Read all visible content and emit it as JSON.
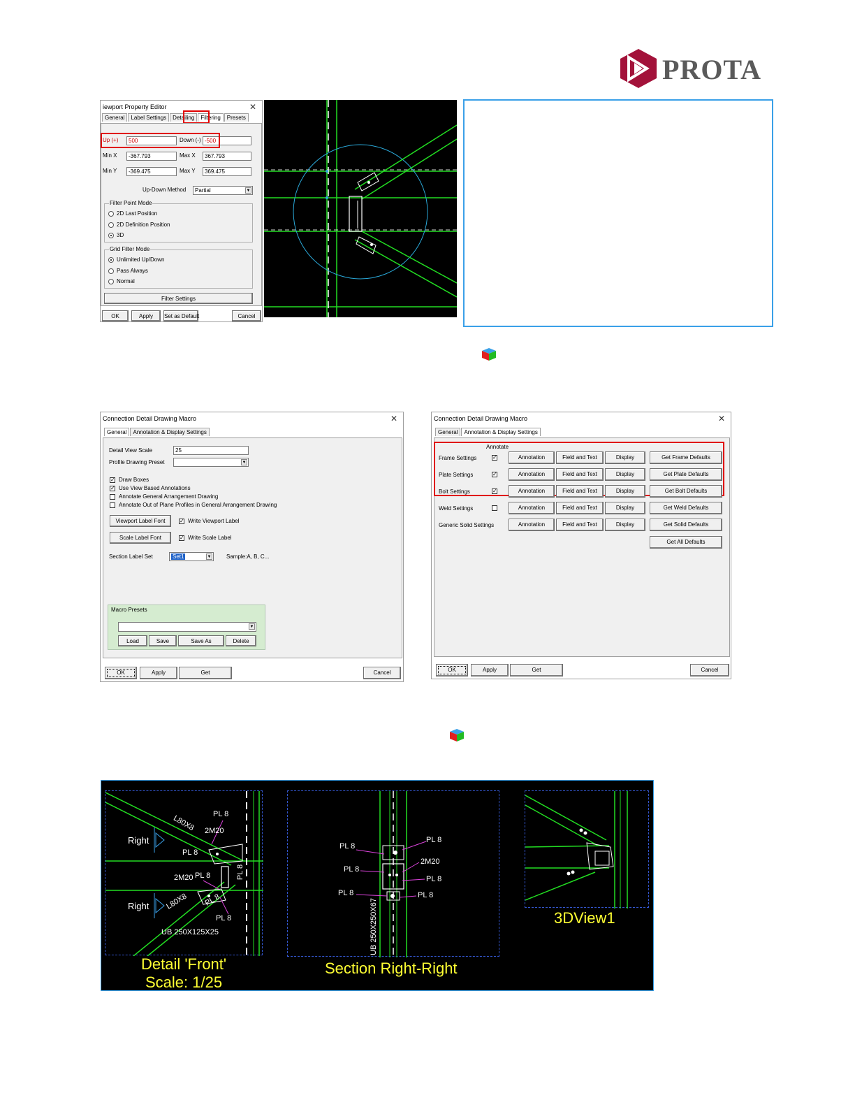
{
  "logo": {
    "text": "PROTA",
    "brand_color": "#a3123a"
  },
  "viewport_editor": {
    "title": "iewport Property Editor",
    "close": "✕",
    "tabs": [
      "General",
      "Label Settings",
      "Detailing",
      "Filtering",
      "Presets"
    ],
    "active_tab": "Filtering",
    "up_label": "Up (+)",
    "up_value": "500",
    "down_label": "Down (-)",
    "down_value": "-500",
    "minx_label": "Min X",
    "minx_value": "-367.793",
    "maxx_label": "Max X",
    "maxx_value": "367.793",
    "miny_label": "Min Y",
    "miny_value": "-369.475",
    "maxy_label": "Max Y",
    "maxy_value": "369.475",
    "updown_label": "Up-Down Method",
    "updown_value": "Partial",
    "filter_point_mode": {
      "title": "Filter Point Mode",
      "options": [
        "2D Last Position",
        "2D Definition Position",
        "3D"
      ],
      "selected": 2
    },
    "grid_filter_mode": {
      "title": "Grid Filter Mode",
      "options": [
        "Unlimited Up/Down",
        "Pass Always",
        "Normal"
      ],
      "selected": 0
    },
    "filter_settings": "Filter Settings",
    "ok": "OK",
    "apply": "Apply",
    "set_default": "Set as Default",
    "cancel": "Cancel"
  },
  "macro_general": {
    "title": "Connection Detail Drawing Macro",
    "close": "✕",
    "tabs": [
      "General",
      "Annotation & Display Settings"
    ],
    "scale_label": "Detail View Scale",
    "scale_value": "25",
    "profile_label": "Profile Drawing Preset",
    "profile_value": "",
    "checks": [
      {
        "label": "Draw Boxes",
        "checked": "✓"
      },
      {
        "label": "Use View Based Annotations",
        "checked": "✓"
      },
      {
        "label": "Annotate General Arrangement Drawing",
        "checked": ""
      },
      {
        "label": "Annotate Out of Plane Profiles in General Arrangement Drawing",
        "checked": ""
      }
    ],
    "viewport_font": "Viewport Label Font",
    "write_viewport": "Write Viewport Label",
    "write_viewport_check": "✓",
    "scale_font": "Scale Label Font",
    "write_scale": "Write Scale Label",
    "write_scale_check": "✓",
    "section_label": "Section Label Set",
    "section_value": "Set1",
    "sample": "Sample:A, B, C...",
    "presets_title": "Macro Presets",
    "load": "Load",
    "save": "Save",
    "save_as": "Save As",
    "delete": "Delete",
    "ok": "OK",
    "apply": "Apply",
    "get": "Get",
    "cancel": "Cancel"
  },
  "macro_annot": {
    "title": "Connection Detail Drawing Macro",
    "close": "✕",
    "tabs": [
      "General",
      "Annotation & Display Settings"
    ],
    "annotate_header": "Annotate",
    "rows": [
      {
        "label": "Frame Settings",
        "check": "✓",
        "annotation": "Annotation",
        "field": "Field and Text",
        "display": "Display",
        "defaults": "Get Frame Defaults"
      },
      {
        "label": "Plate Settings",
        "check": "✓",
        "annotation": "Annotation",
        "field": "Field and Text",
        "display": "Display",
        "defaults": "Get Plate Defaults"
      },
      {
        "label": "Bolt Settings",
        "check": "✓",
        "annotation": "Annotation",
        "field": "Field and Text",
        "display": "Display",
        "defaults": "Get Bolt Defaults"
      },
      {
        "label": "Weld Settings",
        "check": "",
        "annotation": "Annotation",
        "field": "Field and Text",
        "display": "Display",
        "defaults": "Get Weld Defaults"
      },
      {
        "label": "Generic Solid Settings",
        "annotation": "Annotation",
        "field": "Field and Text",
        "display": "Display",
        "defaults": "Get Solid Defaults"
      }
    ],
    "all_defaults": "Get All Defaults",
    "ok": "OK",
    "apply": "Apply",
    "get": "Get",
    "cancel": "Cancel"
  },
  "drawing": {
    "front": {
      "labels": {
        "right1": "Right",
        "right2": "Right",
        "l80a": "L80X8",
        "l80b": "L80X8",
        "pl_a": "PL 8",
        "pl_b": "PL 8",
        "pl_c": "PL 8",
        "pl_d": "PL 8",
        "pl_e": "PL 8",
        "pl_v": "PL 8",
        "m20a": "2M20",
        "m20b": "2M20",
        "ub": "UB 250X125X25"
      },
      "caption1": "Detail 'Front'",
      "caption2": "Scale: 1/25"
    },
    "section": {
      "labels": {
        "pl1": "PL 8",
        "pl2": "PL 8",
        "pl3": "PL 8",
        "pl4": "PL 8",
        "pl5": "PL 8",
        "pl6": "PL 8",
        "m20": "2M20",
        "ub": "UB 250X250X67"
      },
      "caption": "Section Right-Right"
    },
    "view3d": {
      "caption": "3DView1"
    }
  },
  "colors": {
    "highlight_red": "#e00000",
    "cad_green": "#22dd22",
    "cad_caption": "#ffff33",
    "note_border": "#3aa0e8",
    "preset_green": "#d5ecd0"
  }
}
